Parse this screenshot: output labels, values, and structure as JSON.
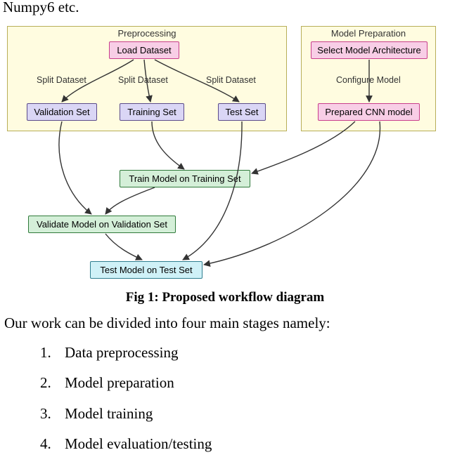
{
  "clip_top_text": "Numpy6 etc.",
  "diagram": {
    "panel_preprocessing": {
      "title": "Preprocessing"
    },
    "panel_modelprep": {
      "title": "Model Preparation"
    },
    "node_load": "Load Dataset",
    "node_select_arch": "Select Model Architecture",
    "edge_split_1": "Split Dataset",
    "edge_split_2": "Split Dataset",
    "edge_split_3": "Split Dataset",
    "edge_configure": "Configure Model",
    "node_validation": "Validation Set",
    "node_training": "Training Set",
    "node_test": "Test Set",
    "node_prepared": "Prepared CNN model",
    "node_train_model": "Train Model on Training Set",
    "node_validate_model": "Validate Model on Validation Set",
    "node_test_model": "Test Model on Test Set"
  },
  "caption": "Fig 1: Proposed workflow diagram",
  "intro_paragraph": "Our work can be divided into four main stages namely:",
  "stages": [
    "Data preprocessing",
    "Model preparation",
    "Model training",
    "Model evaluation/testing"
  ],
  "chart_data": {
    "type": "diagram",
    "title": "Proposed workflow diagram",
    "groups": [
      {
        "id": "preprocessing",
        "label": "Preprocessing",
        "nodes": [
          "load_dataset",
          "validation_set",
          "training_set",
          "test_set"
        ]
      },
      {
        "id": "model_preparation",
        "label": "Model Preparation",
        "nodes": [
          "select_model_architecture",
          "prepared_cnn_model"
        ]
      }
    ],
    "nodes": [
      {
        "id": "load_dataset",
        "label": "Load Dataset",
        "color": "pink",
        "group": "preprocessing"
      },
      {
        "id": "validation_set",
        "label": "Validation Set",
        "color": "purple",
        "group": "preprocessing"
      },
      {
        "id": "training_set",
        "label": "Training Set",
        "color": "purple",
        "group": "preprocessing"
      },
      {
        "id": "test_set",
        "label": "Test Set",
        "color": "purple",
        "group": "preprocessing"
      },
      {
        "id": "select_model_architecture",
        "label": "Select Model Architecture",
        "color": "pink",
        "group": "model_preparation"
      },
      {
        "id": "prepared_cnn_model",
        "label": "Prepared CNN model",
        "color": "pink",
        "group": "model_preparation"
      },
      {
        "id": "train_model",
        "label": "Train Model on Training Set",
        "color": "green"
      },
      {
        "id": "validate_model",
        "label": "Validate Model on Validation Set",
        "color": "green"
      },
      {
        "id": "test_model",
        "label": "Test Model on Test Set",
        "color": "cyan"
      }
    ],
    "edges": [
      {
        "from": "load_dataset",
        "to": "validation_set",
        "label": "Split Dataset"
      },
      {
        "from": "load_dataset",
        "to": "training_set",
        "label": "Split Dataset"
      },
      {
        "from": "load_dataset",
        "to": "test_set",
        "label": "Split Dataset"
      },
      {
        "from": "select_model_architecture",
        "to": "prepared_cnn_model",
        "label": "Configure Model"
      },
      {
        "from": "training_set",
        "to": "train_model"
      },
      {
        "from": "prepared_cnn_model",
        "to": "train_model"
      },
      {
        "from": "validation_set",
        "to": "validate_model"
      },
      {
        "from": "train_model",
        "to": "validate_model"
      },
      {
        "from": "test_set",
        "to": "test_model"
      },
      {
        "from": "validate_model",
        "to": "test_model"
      },
      {
        "from": "prepared_cnn_model",
        "to": "test_model"
      }
    ]
  }
}
